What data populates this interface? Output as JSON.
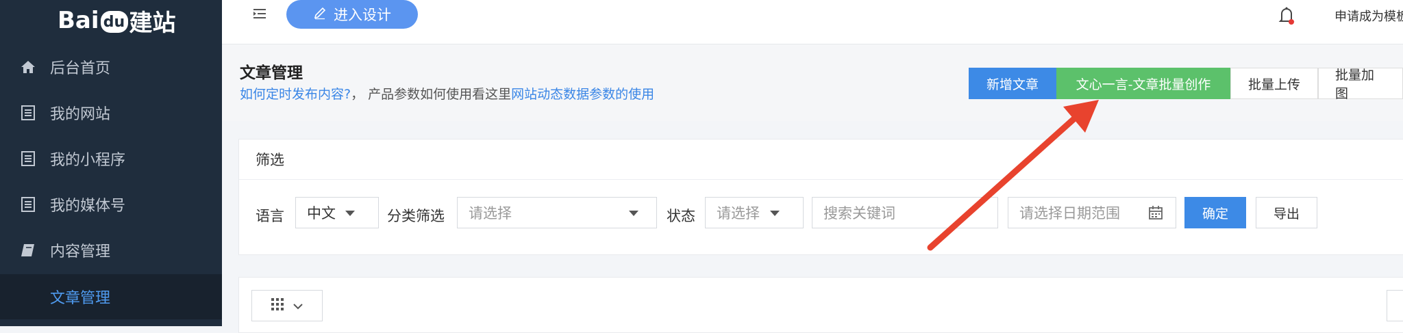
{
  "brand": {
    "logo_left": "Bai",
    "logo_paw": "du",
    "logo_right": "建站"
  },
  "sidebar": {
    "items": [
      {
        "label": "后台首页",
        "icon": "home-icon"
      },
      {
        "label": "我的网站",
        "icon": "list-icon"
      },
      {
        "label": "我的小程序",
        "icon": "list-icon"
      },
      {
        "label": "我的媒体号",
        "icon": "list-icon"
      },
      {
        "label": "内容管理",
        "icon": "book-icon"
      }
    ],
    "active_sub": "文章管理"
  },
  "topbar": {
    "design_label": "进入设计",
    "apply_label": "申请成为模板"
  },
  "header": {
    "title": "文章管理",
    "help_link1": "如何定时发布内容?",
    "help_mid": "，  产品参数如何使用看这里",
    "help_link2": "网站动态数据参数的使用",
    "buttons": {
      "add": "新增文章",
      "ai": "文心一言-文章批量创作",
      "upload": "批量上传",
      "addimg": "批量加图"
    }
  },
  "filter": {
    "title": "筛选",
    "language_label": "语言",
    "language_value": "中文",
    "category_label": "分类筛选",
    "category_placeholder": "请选择",
    "status_label": "状态",
    "status_placeholder": "请选择",
    "keyword_placeholder": "搜索关键词",
    "date_placeholder": "请选择日期范围",
    "confirm": "确定",
    "export": "导出"
  },
  "colors": {
    "sidebar": "#1f2d3d",
    "primary": "#3d8ae6",
    "green": "#5cc16b",
    "arrow": "#e8432e"
  }
}
